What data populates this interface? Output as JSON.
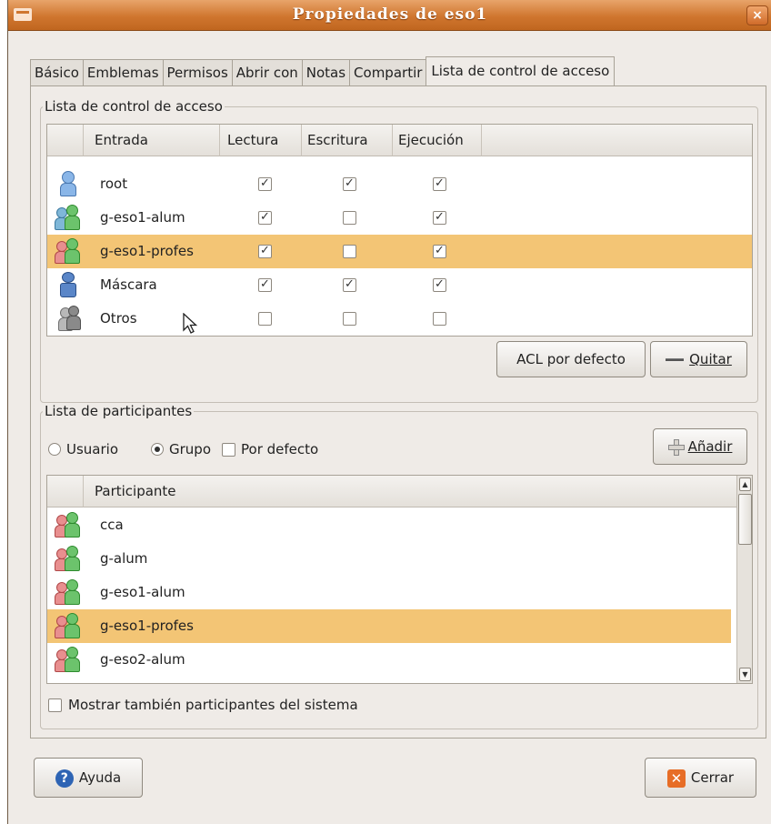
{
  "window": {
    "title": "Propiedades de eso1",
    "close_symbol": "×"
  },
  "tabs": [
    "Básico",
    "Emblemas",
    "Permisos",
    "Abrir con",
    "Notas",
    "Compartir",
    "Lista de control de acceso"
  ],
  "acl": {
    "frame_label": "Lista de control de acceso",
    "columns": {
      "entry": "Entrada",
      "read": "Lectura",
      "write": "Escritura",
      "exec": "Ejecución"
    },
    "rows": [
      {
        "name": "root",
        "icon": "user-icon",
        "read": true,
        "write": true,
        "exec": true,
        "selected": false
      },
      {
        "name": "g-eso1-alum",
        "icon": "group-icon",
        "read": true,
        "write": false,
        "exec": true,
        "selected": false
      },
      {
        "name": "g-eso1-profes",
        "icon": "group-icon",
        "read": true,
        "write": false,
        "exec": true,
        "selected": true
      },
      {
        "name": "Máscara",
        "icon": "mask-icon",
        "read": true,
        "write": true,
        "exec": true,
        "selected": false
      },
      {
        "name": "Otros",
        "icon": "others-icon",
        "read": false,
        "write": false,
        "exec": false,
        "selected": false
      }
    ],
    "default_acl_button": "ACL por defecto",
    "remove_button": "Quitar"
  },
  "participants": {
    "frame_label": "Lista de participantes",
    "options": {
      "user": "Usuario",
      "group": "Grupo",
      "default": "Por defecto"
    },
    "selected_option": "group",
    "default_checked": false,
    "add_button": "Añadir",
    "column": "Participante",
    "rows": [
      {
        "name": "cca",
        "selected": false
      },
      {
        "name": "g-alum",
        "selected": false
      },
      {
        "name": "g-eso1-alum",
        "selected": false
      },
      {
        "name": "g-eso1-profes",
        "selected": true
      },
      {
        "name": "g-eso2-alum",
        "selected": false
      }
    ],
    "show_system_label": "Mostrar también participantes del sistema",
    "show_system_checked": false
  },
  "footer": {
    "help_button": "Ayuda",
    "close_button": "Cerrar"
  },
  "colors": {
    "titlebar": "#d0762f",
    "selection": "#f3c575",
    "background": "#efebe7"
  }
}
